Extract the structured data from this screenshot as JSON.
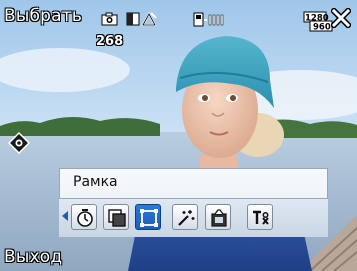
{
  "softkeys": {
    "left": "Выбрать",
    "right": "Выход"
  },
  "status": {
    "shots_remaining": "268",
    "resolution_top": "1280",
    "resolution_bottom": "960"
  },
  "panel": {
    "title": "Рамка",
    "tools": [
      {
        "name": "self-timer-icon",
        "selected": false
      },
      {
        "name": "capture-mode-icon",
        "selected": false
      },
      {
        "name": "frame-icon",
        "selected": true
      },
      {
        "name": "effect-icon",
        "selected": false
      },
      {
        "name": "picture-icon",
        "selected": false
      },
      {
        "name": "settings-icon",
        "selected": false
      }
    ]
  },
  "colors": {
    "osd_text": "#ffffff",
    "selected_tool": "#1d5fb6",
    "panel_border": "#9aa6b4"
  }
}
